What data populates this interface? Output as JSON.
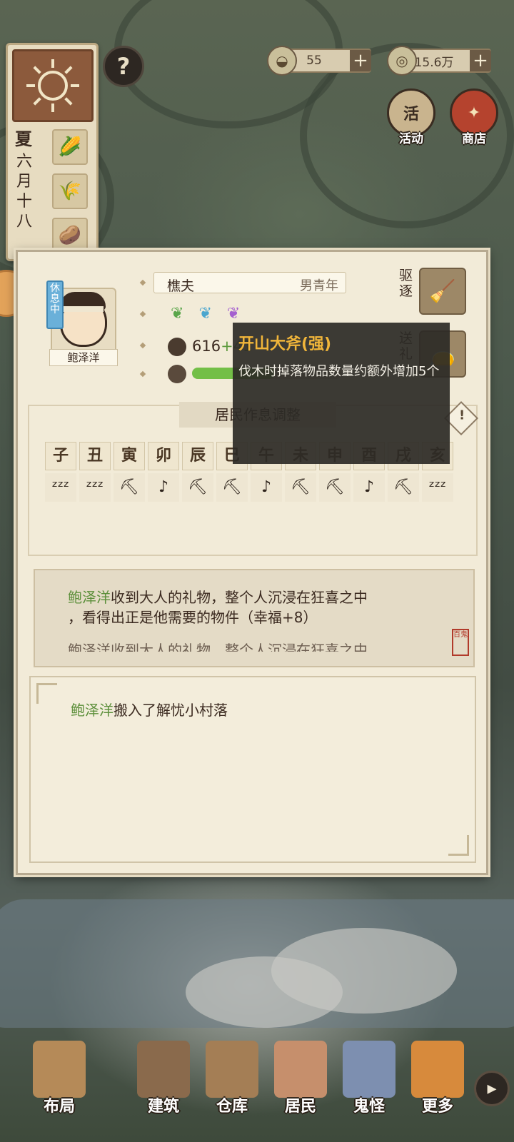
{
  "hud": {
    "season": "夏",
    "date_chars": [
      "六",
      "月",
      "十",
      "八"
    ],
    "help_label": "?",
    "silver": "55",
    "coins": "15.6万",
    "plus": "+",
    "activity_icon_text": "活",
    "activity_label": "活动",
    "shop_label": "商店"
  },
  "resident": {
    "status": "休息中",
    "name": "鲍泽洋",
    "job": "樵夫",
    "info": "男青年",
    "strength": "616",
    "strength_bonus": "+41",
    "happiness_fraction": 0.55,
    "traits": [
      "green-trait-icon",
      "blue-trait-icon",
      "purple-trait-icon"
    ]
  },
  "actions": {
    "expel": [
      "驱",
      "逐"
    ],
    "gift": [
      "送",
      "礼"
    ]
  },
  "schedule": {
    "title": "居民作息调整",
    "warn": "!",
    "hours": [
      "子",
      "丑",
      "寅",
      "卯",
      "辰",
      "巳",
      "午",
      "未",
      "申",
      "酉",
      "戌",
      "亥"
    ],
    "activities": [
      "z",
      "z",
      "w",
      "m",
      "w",
      "w",
      "m",
      "w",
      "w",
      "m",
      "w",
      "z"
    ]
  },
  "tooltip": {
    "title": "开山大斧(强)",
    "body": "伐木时掉落物品数量约额外增加5个"
  },
  "logs": {
    "entry1_name": "鲍泽洋",
    "entry1_text": "收到大人的礼物，整个人沉浸在狂喜之中",
    "entry1_cont": "，看得出正是他需要的物件（幸福+8）",
    "entry1_faded": "鲍泽洋收到大人的礼物，整个人沉浸在狂喜之中",
    "seal": "百鬼",
    "entry2_name": "鲍泽洋",
    "entry2_text": "搬入了解忧小村落"
  },
  "nav": {
    "layout": "布局",
    "build": "建筑",
    "storage": "仓库",
    "residents": "居民",
    "ghosts": "鬼怪",
    "more": "更多"
  },
  "colors": {
    "accent_green": "#5c8f3a",
    "tooltip_title": "#f0b53a",
    "happiness_bar": "#73bf47"
  }
}
